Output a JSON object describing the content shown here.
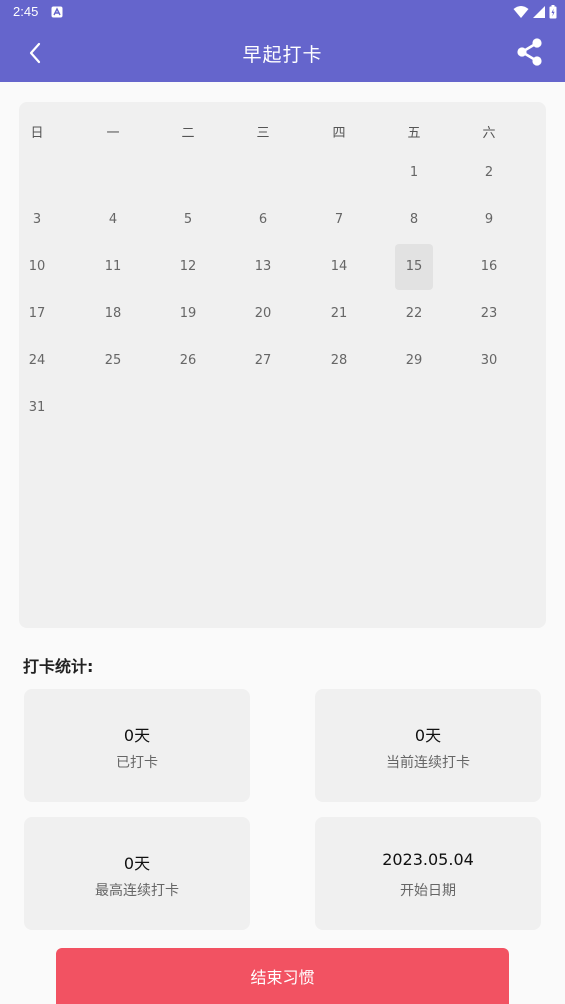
{
  "status_bar": {
    "time": "2:45",
    "icons": [
      "notification-app-icon",
      "wifi-icon",
      "cell-signal-icon",
      "battery-icon"
    ]
  },
  "app_bar": {
    "title": "早起打卡",
    "back_icon": "chevron-left-icon",
    "share_icon": "share-icon",
    "background_color": "#6565cc"
  },
  "calendar": {
    "weekdays": [
      "日",
      "一",
      "二",
      "三",
      "四",
      "五",
      "六"
    ],
    "first_weekday_index": 5,
    "days_in_month": 31,
    "highlighted_day": 15,
    "days": [
      "1",
      "2",
      "3",
      "4",
      "5",
      "6",
      "7",
      "8",
      "9",
      "10",
      "11",
      "12",
      "13",
      "14",
      "15",
      "16",
      "17",
      "18",
      "19",
      "20",
      "21",
      "22",
      "23",
      "24",
      "25",
      "26",
      "27",
      "28",
      "29",
      "30",
      "31"
    ]
  },
  "stats": {
    "heading": "打卡统计:",
    "cards": [
      {
        "value": "0天",
        "label": "已打卡"
      },
      {
        "value": "0天",
        "label": "当前连续打卡"
      },
      {
        "value": "0天",
        "label": "最高连续打卡"
      },
      {
        "value": "2023.05.04",
        "label": "开始日期"
      }
    ]
  },
  "end_button": {
    "label": "结束习惯",
    "color": "#f25262"
  }
}
